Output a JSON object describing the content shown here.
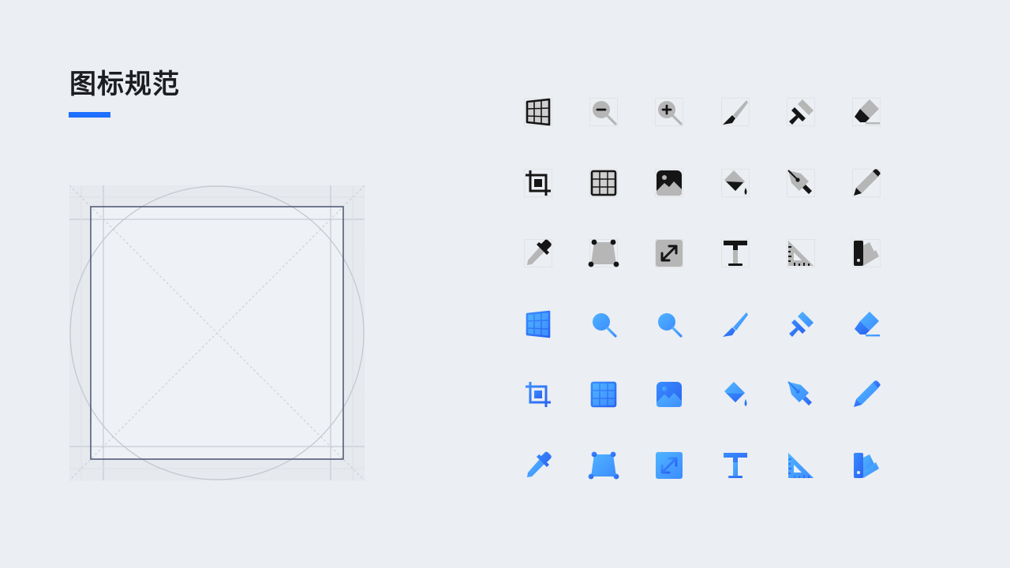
{
  "page": {
    "title": "图标规范"
  },
  "colors": {
    "background": "#ebeef2",
    "accent": "#1e6fff",
    "mono_dark": "#151515",
    "mono_gray": "#b6b6b6",
    "mono_box": "#d9d9d9",
    "blue_light": "#4fb4ff",
    "blue_dark": "#2a63f0"
  },
  "icon_rows": [
    {
      "style": "mono",
      "icons": [
        "perspective-grid-icon",
        "zoom-out-icon",
        "zoom-in-icon",
        "brush-icon",
        "paint-roller-icon",
        "eraser-icon"
      ]
    },
    {
      "style": "mono",
      "icons": [
        "crop-icon",
        "grid-icon",
        "image-icon",
        "paint-bucket-icon",
        "pen-nib-icon",
        "pencil-icon"
      ]
    },
    {
      "style": "mono",
      "icons": [
        "eyedropper-icon",
        "distort-icon",
        "resize-icon",
        "text-icon",
        "triangle-ruler-icon",
        "swatches-icon"
      ]
    },
    {
      "style": "blue",
      "icons": [
        "perspective-grid-icon",
        "zoom-out-icon",
        "zoom-in-icon",
        "brush-icon",
        "paint-roller-icon",
        "eraser-icon"
      ]
    },
    {
      "style": "blue",
      "icons": [
        "crop-icon",
        "grid-icon",
        "image-icon",
        "paint-bucket-icon",
        "pen-nib-icon",
        "pencil-icon"
      ]
    },
    {
      "style": "blue",
      "icons": [
        "eyedropper-icon",
        "distort-icon",
        "resize-icon",
        "text-icon",
        "triangle-ruler-icon",
        "swatches-icon"
      ]
    }
  ]
}
